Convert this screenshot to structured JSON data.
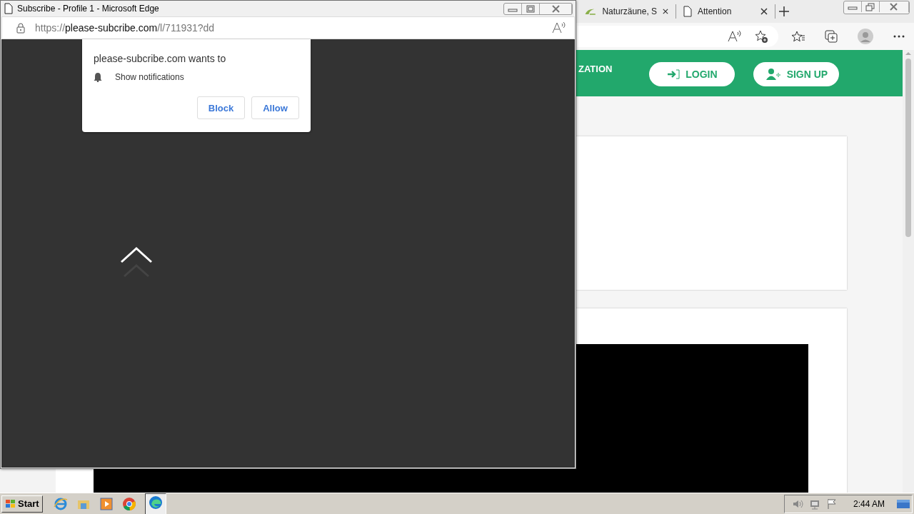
{
  "browser": {
    "tabs": [
      {
        "label": "Naturzäune, S",
        "kind": "site"
      },
      {
        "label": "Attention",
        "kind": "page"
      }
    ],
    "header": {
      "nav_text": "ZATION",
      "buttons": [
        {
          "label": "LOGIN",
          "kind": "login"
        },
        {
          "label": "SIGN UP",
          "kind": "signup"
        }
      ]
    }
  },
  "popup": {
    "title": "Subscribe - Profile 1 - Microsoft Edge",
    "url_scheme": "https://",
    "url_host": "please-subcribe.com",
    "url_path": "/l/711931?dd",
    "prompt": {
      "title": "please-subcribe.com wants to",
      "permission": "Show notifications",
      "buttons": [
        "Block",
        "Allow"
      ]
    }
  },
  "taskbar": {
    "start": "Start",
    "clock": "2:44 AM"
  }
}
